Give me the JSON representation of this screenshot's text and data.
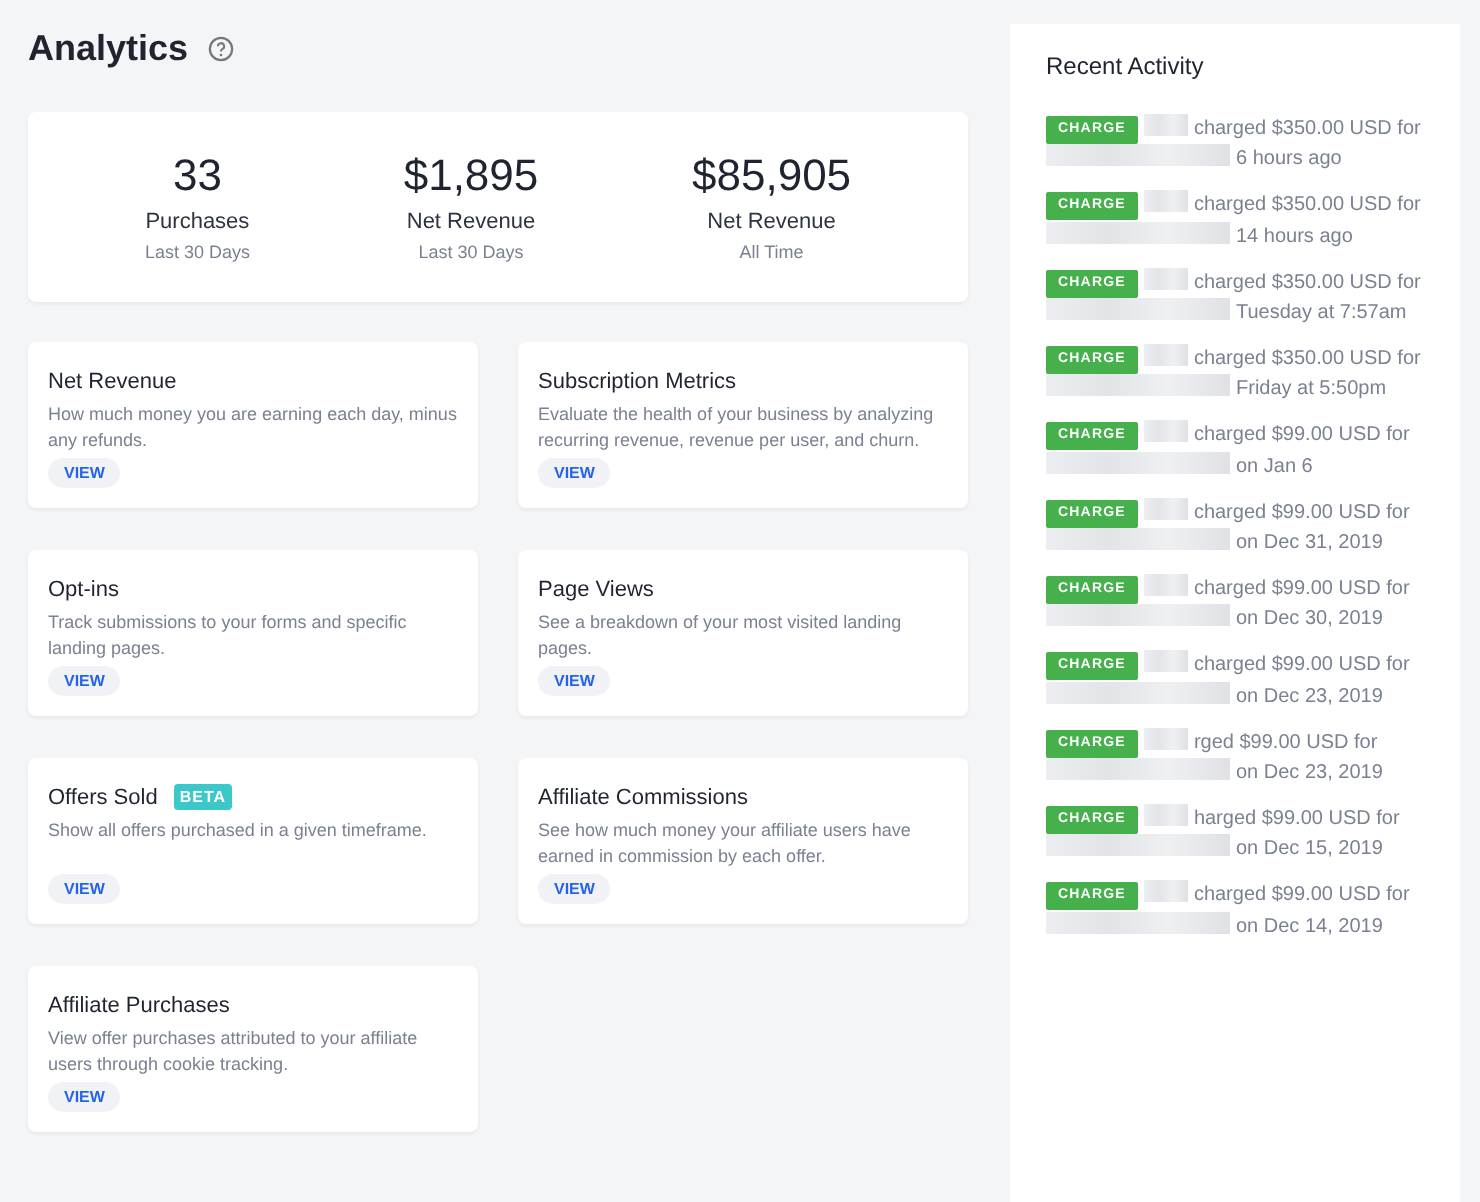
{
  "page": {
    "title": "Analytics"
  },
  "stats": [
    {
      "value": "33",
      "label": "Purchases",
      "period": "Last 30 Days"
    },
    {
      "value": "$1,895",
      "label": "Net Revenue",
      "period": "Last 30 Days"
    },
    {
      "value": "$85,905",
      "label": "Net Revenue",
      "period": "All Time"
    }
  ],
  "reports": [
    {
      "title": "Net Revenue",
      "description": "How much money you are earning each day, minus any refunds.",
      "button": "VIEW"
    },
    {
      "title": "Subscription Metrics",
      "description": "Evaluate the health of your business by analyzing recurring revenue, revenue per user, and churn.",
      "button": "VIEW"
    },
    {
      "title": "Opt-ins",
      "description": "Track submissions to your forms and specific landing pages.",
      "button": "VIEW"
    },
    {
      "title": "Page Views",
      "description": "See a breakdown of your most visited landing pages.",
      "button": "VIEW"
    },
    {
      "title": "Offers Sold",
      "badge": "BETA",
      "description": "Show all offers purchased in a given timeframe.",
      "button": "VIEW"
    },
    {
      "title": "Affiliate Commissions",
      "description": "See how much money your affiliate users have earned in commission by each offer.",
      "button": "VIEW"
    },
    {
      "title": "Affiliate Purchases",
      "description": "View offer purchases attributed to your affiliate users through cookie tracking.",
      "button": "VIEW"
    }
  ],
  "recent_activity": {
    "title": "Recent Activity",
    "items": [
      {
        "badge": "CHARGE",
        "action": "charged $350.00 USD for",
        "when": "6 hours ago"
      },
      {
        "badge": "CHARGE",
        "action": "charged $350.00 USD for",
        "when": "14 hours ago"
      },
      {
        "badge": "CHARGE",
        "action": "charged $350.00 USD for",
        "when": "Tuesday at 7:57am"
      },
      {
        "badge": "CHARGE",
        "action": "charged $350.00 USD for",
        "when": "Friday at 5:50pm"
      },
      {
        "badge": "CHARGE",
        "action": "charged $99.00 USD for",
        "when": "on Jan 6"
      },
      {
        "badge": "CHARGE",
        "action": "charged $99.00 USD for",
        "when": "on Dec 31, 2019"
      },
      {
        "badge": "CHARGE",
        "action": "charged $99.00 USD for",
        "when": "on Dec 30, 2019"
      },
      {
        "badge": "CHARGE",
        "action": "charged $99.00 USD for",
        "when": "on Dec 23, 2019"
      },
      {
        "badge": "CHARGE",
        "action": "rged $99.00 USD for",
        "when": "on Dec 23, 2019"
      },
      {
        "badge": "CHARGE",
        "action": "harged $99.00 USD for",
        "when": "on Dec 15, 2019"
      },
      {
        "badge": "CHARGE",
        "action": "charged $99.00 USD for",
        "when": "on Dec 14, 2019"
      }
    ]
  }
}
